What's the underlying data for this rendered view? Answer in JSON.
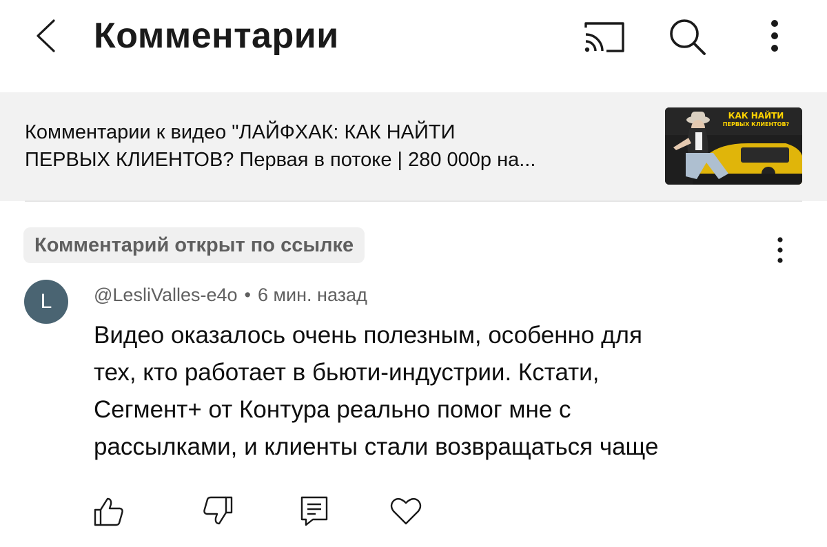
{
  "header": {
    "title": "Комментарии",
    "icons": [
      "chevron-left-icon",
      "cast-icon",
      "search-icon",
      "more-vertical-icon"
    ]
  },
  "video": {
    "title_line1": "Комментарии к видео \"ЛАЙФХАК: КАК НАЙТИ",
    "title_line2": "ПЕРВЫХ КЛИЕНТОВ? Первая в потоке | 280 000р на...",
    "thumbnail": {
      "headline": "КАК НАЙТИ",
      "subline": "ПЕРВЫХ КЛИЕНТОВ?",
      "accent_color": "#ffd400"
    }
  },
  "linked_badge": "Комментарий открыт по ссылке",
  "comment": {
    "avatar_letter": "L",
    "avatar_color": "#4a6472",
    "author": "@LesliValles-e4o",
    "separator": "•",
    "time": "6 мин. назад",
    "lines": [
      "Видео оказалось очень полезным, особенно для",
      "тех, кто работает в бьюти-индустрии. Кстати,",
      "Сегмент+ от Контура реально помог мне с",
      "рассылками, и клиенты стали возвращаться чаще"
    ],
    "actions": [
      "thumb-up-icon",
      "thumb-down-icon",
      "reply-icon",
      "heart-icon"
    ]
  }
}
